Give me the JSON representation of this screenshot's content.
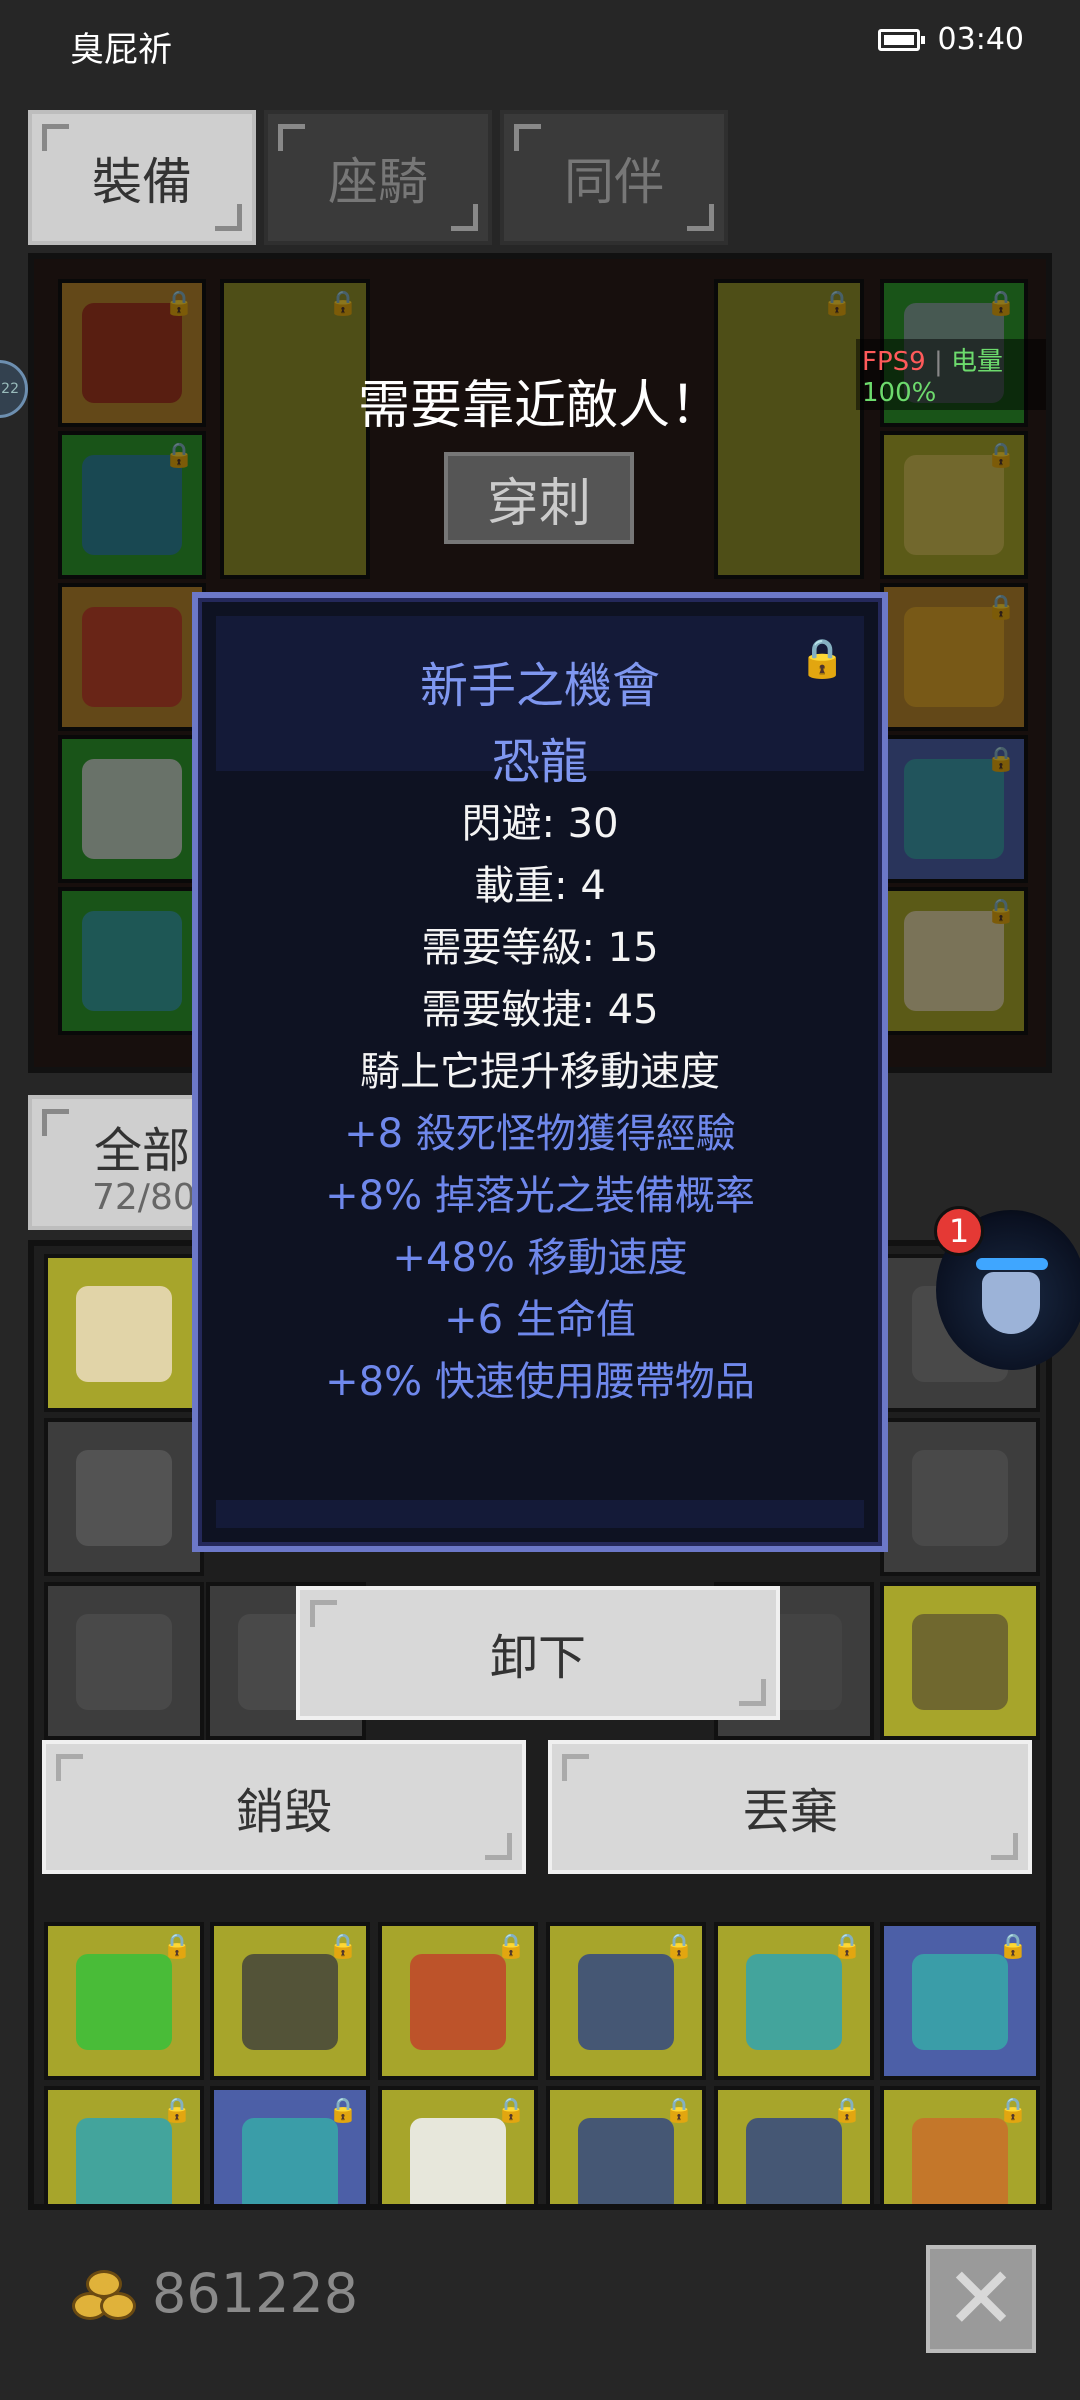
{
  "status_bar": {
    "carrier": "臭屁祈",
    "time": "03:40"
  },
  "tabs": [
    {
      "label": "裝備",
      "active": true
    },
    {
      "label": "座騎",
      "active": false
    },
    {
      "label": "同伴",
      "active": false
    }
  ],
  "overlay": {
    "message": "需要靠近敵人！",
    "skill_label": "穿刺",
    "fps_label": "FPS9",
    "fps_sep": "|",
    "power_label": "电量100%",
    "side_badge": "22"
  },
  "inventory": {
    "tab_label": "全部",
    "count": "72/80"
  },
  "tooltip": {
    "name": "新手之機會",
    "type": "恐龍",
    "lock_icon": "lock-icon",
    "stats": [
      {
        "text": "閃避: 30",
        "color": "#f4f4f4"
      },
      {
        "text": "載重: 4",
        "color": "#f4f4f4"
      },
      {
        "text": "需要等級: 15",
        "color": "#f4f4f4"
      },
      {
        "text": "需要敏捷: 45",
        "color": "#f4f4f4"
      },
      {
        "text": "騎上它提升移動速度",
        "color": "#f4f4f4"
      },
      {
        "text": "+8 殺死怪物獲得經驗",
        "color": "#6f88ec"
      },
      {
        "text": "+8% 掉落光之裝備概率",
        "color": "#6f88ec"
      },
      {
        "text": "+48% 移動速度",
        "color": "#6f88ec"
      },
      {
        "text": "+6 生命值",
        "color": "#6f88ec"
      },
      {
        "text": "+8% 快速使用腰帶物品",
        "color": "#6f88ec"
      }
    ]
  },
  "actions": {
    "unequip": "卸下",
    "destroy": "銷毀",
    "discard": "丟棄"
  },
  "float": {
    "badge": "1"
  },
  "footer": {
    "gold": "861228",
    "close_icon": "close-icon"
  }
}
